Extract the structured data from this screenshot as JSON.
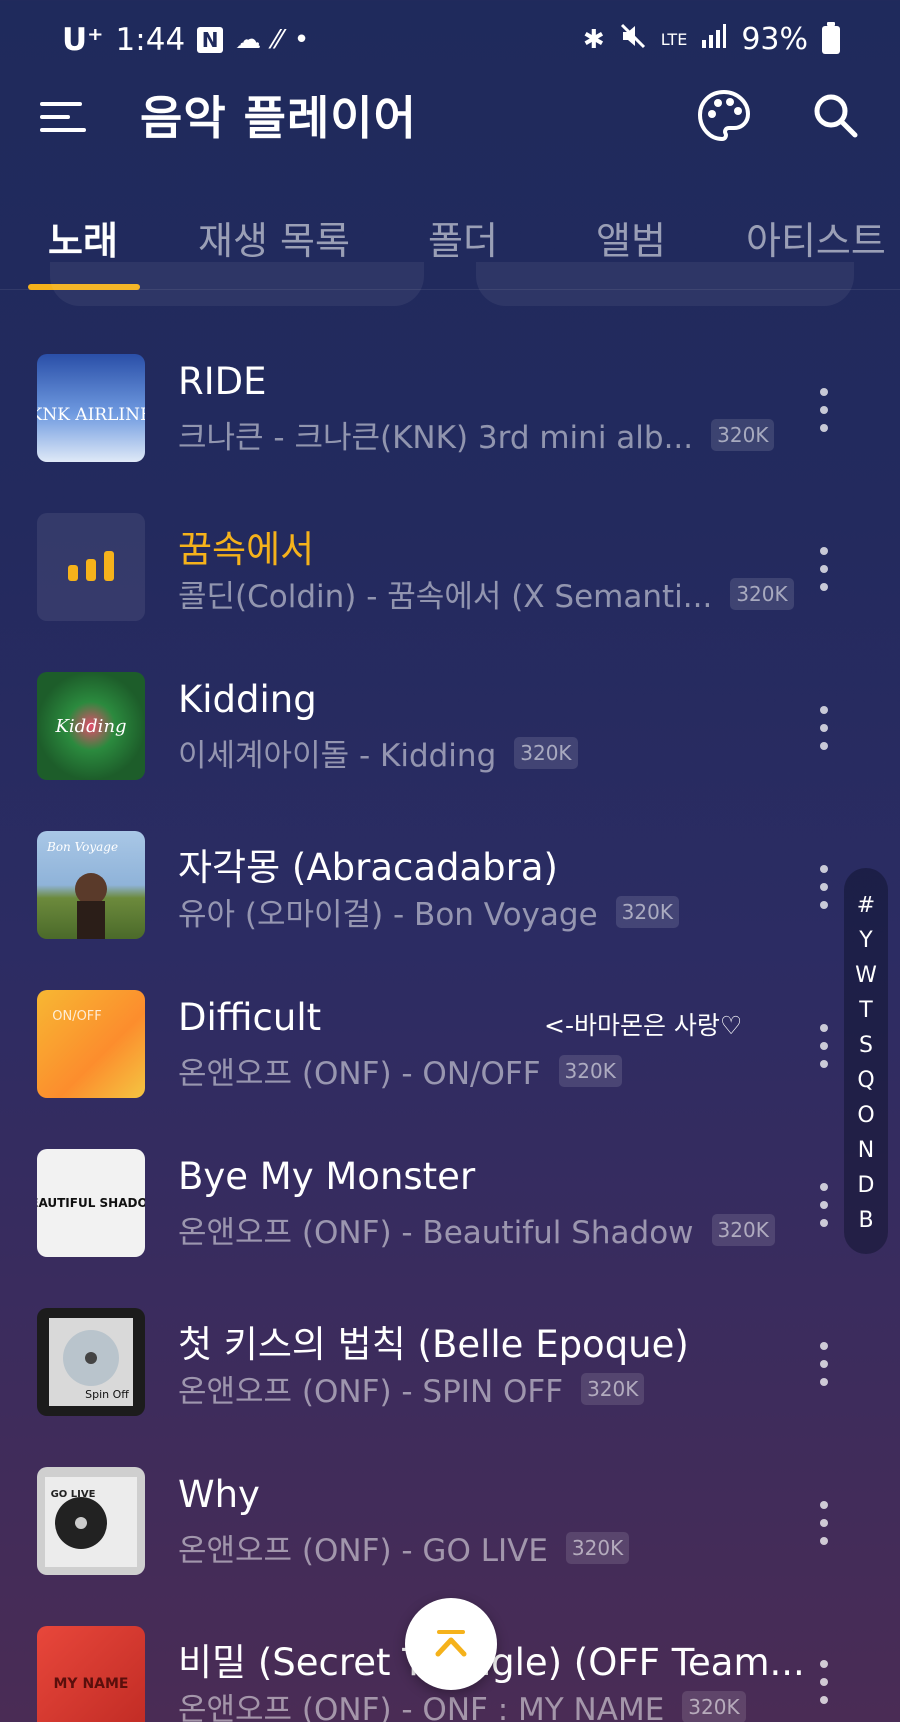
{
  "status_bar": {
    "carrier": "U⁺",
    "time": "1:44",
    "n_icon": "N",
    "notif_icons": [
      "cloud-icon",
      "rain-icon",
      "dot-icon"
    ],
    "sys_icons": [
      "bluetooth-icon",
      "mute-icon",
      "lte-icon",
      "signal-icon"
    ],
    "lte": "LTE",
    "battery": "93%"
  },
  "app": {
    "title": "음악 플레이어",
    "accent": "#f5b21b"
  },
  "tabs": [
    {
      "label": "노래",
      "active": true
    },
    {
      "label": "재생 목록",
      "active": false
    },
    {
      "label": "폴더",
      "active": false
    },
    {
      "label": "앨범",
      "active": false
    },
    {
      "label": "아티스트",
      "active": false
    }
  ],
  "songs": [
    {
      "title": "RIDE",
      "subtitle": "크나큰 - 크나큰(KNK) 3rd mini alb...",
      "quality": "320K",
      "playing": false
    },
    {
      "title": "꿈속에서",
      "subtitle": "콜딘(Coldin) - 꿈속에서 (X Semanti...",
      "quality": "320K",
      "playing": true
    },
    {
      "title": "Kidding",
      "subtitle": "이세계아이돌 - Kidding",
      "quality": "320K",
      "playing": false
    },
    {
      "title": "자각몽 (Abracadabra)",
      "subtitle": "유아 (오마이걸) - Bon Voyage",
      "quality": "320K",
      "playing": false
    },
    {
      "title": "Difficult",
      "subtitle": "온앤오프 (ONF) - ON/OFF",
      "quality": "320K",
      "playing": false,
      "note": "<-바마몬은 사랑♡"
    },
    {
      "title": "Bye My Monster",
      "subtitle": "온앤오프 (ONF) - Beautiful Shadow",
      "quality": "320K",
      "playing": false
    },
    {
      "title": "첫 키스의 법칙 (Belle Epoque)",
      "subtitle": "온앤오프 (ONF) - SPIN OFF",
      "quality": "320K",
      "playing": false
    },
    {
      "title": "Why",
      "subtitle": "온앤오프 (ONF) - GO LIVE",
      "quality": "320K",
      "playing": false
    },
    {
      "title": "비밀 (Secret Triangle) (OFF Team...",
      "subtitle": "온앤오프 (ONF) - ONF : MY NAME",
      "quality": "320K",
      "playing": false
    }
  ],
  "index_letters": [
    "#",
    "Y",
    "W",
    "T",
    "S",
    "Q",
    "O",
    "N",
    "D",
    "B"
  ],
  "album_art": [
    {
      "label": "KNK AIRLINE",
      "bg": "linear-gradient(160deg,#2a4fa8,#6f9ae0 55%,#c9dcf5)"
    },
    {
      "label": "",
      "bg": ""
    },
    {
      "label": "Kidding",
      "bg": "radial-gradient(circle,#e24b6b 0%,#2b8a3e 45%,#1d5d2a 100%)"
    },
    {
      "label": "Bon Voyage",
      "bg": "linear-gradient(180deg,#a9c7e6 0%,#8fb3d9 45%,#6c8a3c 60%,#4b6a2a 100%)"
    },
    {
      "label": "ON/OFF",
      "bg": "linear-gradient(135deg,#f7b733,#fc8d2d 60%,#f4c542)"
    },
    {
      "label": "BEAUTIFUL SHADOW",
      "bg": "#f2f2f2"
    },
    {
      "label": "Spin Off",
      "bg": "#1c1c1c"
    },
    {
      "label": "GO LIVE",
      "bg": "#cfcfcf"
    },
    {
      "label": "MY NAME",
      "bg": "linear-gradient(160deg,#e8473b,#c02b24)"
    }
  ]
}
